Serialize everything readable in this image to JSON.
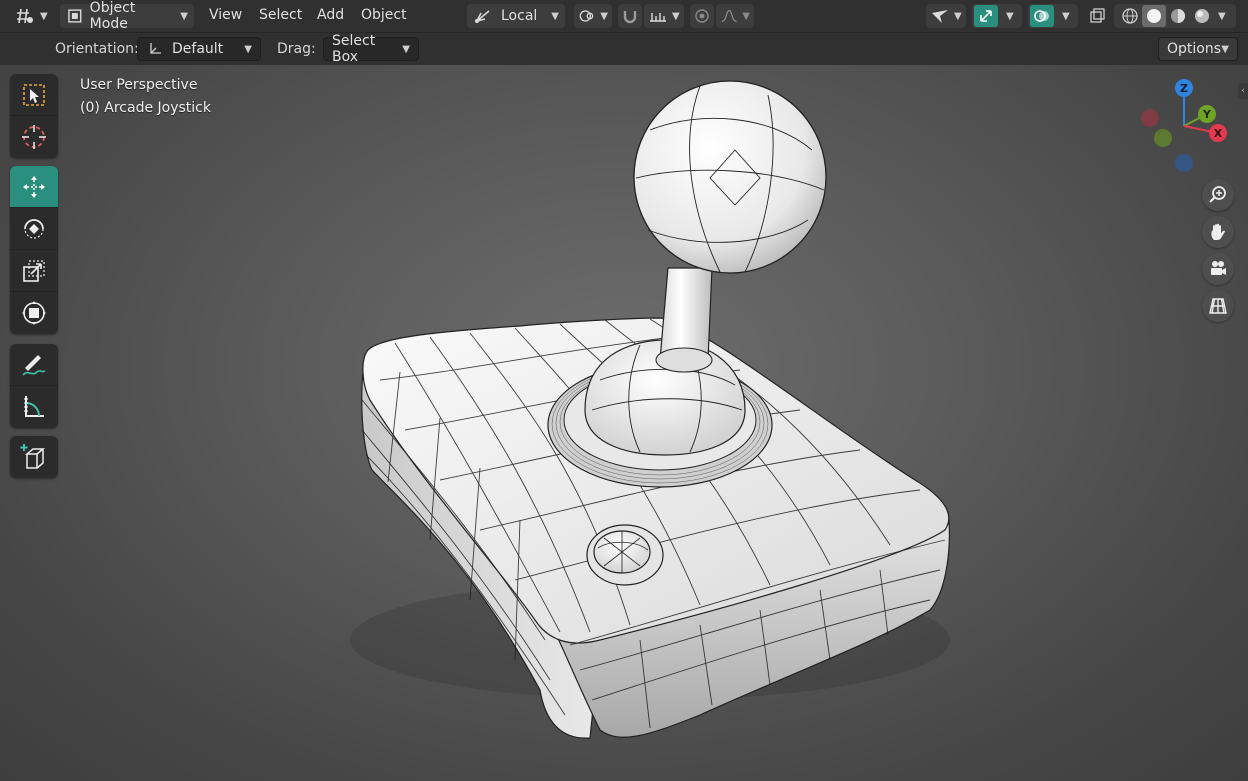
{
  "header": {
    "mode_label": "Object Mode",
    "menu": [
      "View",
      "Select",
      "Add",
      "Object"
    ],
    "transform_orientation": "Local",
    "options_label": "Options"
  },
  "tool_settings": {
    "orientation_label": "Orientation:",
    "orientation_value": "Default",
    "drag_label": "Drag:",
    "drag_value": "Select Box"
  },
  "viewport": {
    "view_name": "User Perspective",
    "object_name": "(0) Arcade Joystick"
  },
  "toolbar": [
    [
      "select-box-icon",
      "cursor-icon"
    ],
    [
      "move-icon",
      "rotate-icon",
      "scale-icon",
      "transform-icon"
    ],
    [
      "annotate-icon",
      "measure-icon"
    ],
    [
      "add-cube-icon"
    ]
  ],
  "active_tool": "move-icon",
  "gizmo": {
    "z": "Z",
    "y": "Y",
    "x": "X"
  },
  "colors": {
    "accent": "#2a8f7f",
    "axis_x": "#e2394f",
    "axis_y": "#6fa326",
    "axis_z": "#2f84e0"
  }
}
